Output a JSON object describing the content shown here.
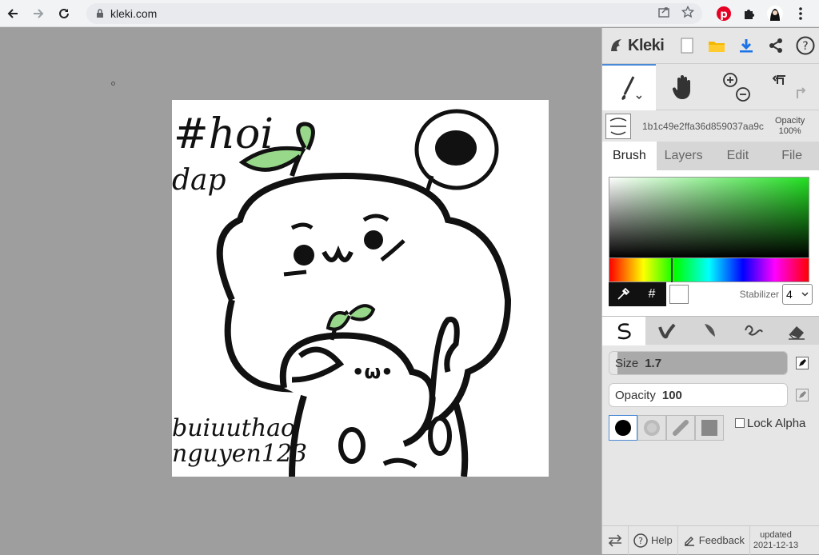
{
  "browser": {
    "url": "kleki.com"
  },
  "app": {
    "logo_label": "Kleki"
  },
  "layer": {
    "name": "1b1c49e2ffa36d859037aa9c",
    "opacity_label": "Opacity",
    "opacity_value": "100%"
  },
  "tabs": [
    {
      "label": "Brush",
      "active": true
    },
    {
      "label": "Layers",
      "active": false
    },
    {
      "label": "Edit",
      "active": false
    },
    {
      "label": "File",
      "active": false
    }
  ],
  "color": {
    "hex_button": "#",
    "stabilizer_label": "Stabilizer",
    "stabilizer_value": "4"
  },
  "brush": {
    "size_label": "Size",
    "size_value": "1.7",
    "opacity_label": "Opacity",
    "opacity_value": "100",
    "lock_alpha_label": "Lock Alpha"
  },
  "footer": {
    "help": "Help",
    "feedback": "Feedback",
    "updated_label": "updated",
    "updated_date": "2021-12-13"
  },
  "drawing": {
    "hashtag_line1": "#hoi",
    "hashtag_line2": "dap",
    "signature_line1": "buiuuthao",
    "signature_line2": "nguyen123",
    "small_face": "•ω•"
  }
}
